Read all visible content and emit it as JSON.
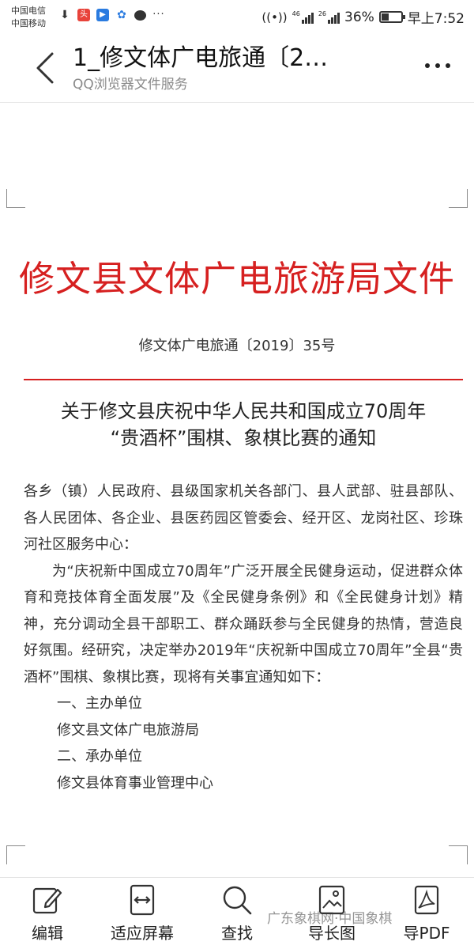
{
  "status_bar": {
    "carrier_1": "中国电信",
    "carrier_2": "中国移动",
    "network_1": "46",
    "network_2": "26",
    "battery": "36%",
    "time": "早上7:52"
  },
  "header": {
    "title": "1_修文体广电旅通〔2…",
    "subtitle": "QQ浏览器文件服务"
  },
  "document": {
    "org_header": "修文县文体广电旅游局文件",
    "doc_number": "修文体广电旅通〔2019〕35号",
    "title_line_1": "关于修文县庆祝中华人民共和国成立70周年",
    "title_line_2": "“贵酒杯”围棋、象棋比赛的通知",
    "addressees": "各乡（镇）人民政府、县级国家机关各部门、县人武部、驻县部队、各人民团体、各企业、县医药园区管委会、经开区、龙岗社区、珍珠河社区服务中心：",
    "paragraph": "为“庆祝新中国成立70周年”广泛开展全民健身运动，促进群众体育和竞技体育全面发展”及《全民健身条例》和《全民健身计划》精神，充分调动全县干部职工、群众踊跃参与全民健身的热情，营造良好氛围。经研究，决定举办2019年“庆祝新中国成立70周年”全县“贵酒杯”围棋、象棋比赛，现将有关事宜通知如下：",
    "section_1_heading": "一、主办单位",
    "section_1_content": "修文县文体广电旅游局",
    "section_2_heading": "二、承办单位",
    "section_2_content": "修文县体育事业管理中心"
  },
  "toolbar": {
    "edit": "编辑",
    "fit_screen": "适应屏幕",
    "find": "查找",
    "export_image": "导长图",
    "export_pdf": "导PDF"
  },
  "watermark": "广东象棋网·中国象棋",
  "colors": {
    "red_header": "#d62020",
    "rule": "#d62020",
    "subtitle_gray": "#8a8a8a"
  },
  "icons": [
    "download-icon",
    "news-app-icon",
    "video-app-icon",
    "baidu-icon",
    "chat-icon",
    "more-icon",
    "hotspot-icon",
    "signal-icon",
    "battery-icon",
    "back-icon",
    "more-menu-icon",
    "edit-icon",
    "fit-screen-icon",
    "search-icon",
    "long-image-icon",
    "pdf-icon"
  ]
}
